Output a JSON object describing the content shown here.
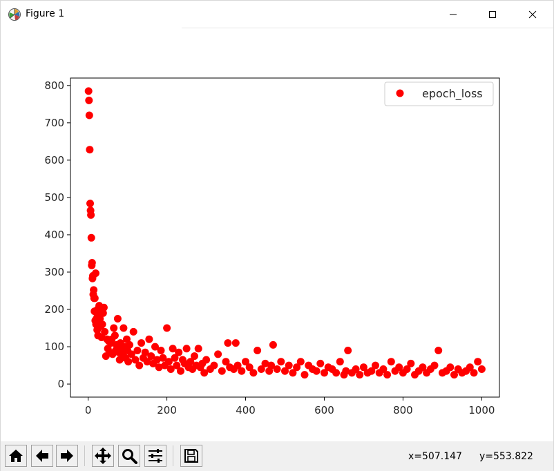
{
  "window": {
    "title": "Figure 1",
    "icons": [
      "matplotlib-icon",
      "minimize-icon",
      "maximize-icon",
      "close-icon"
    ]
  },
  "toolbar": {
    "tools": [
      {
        "name": "home-button",
        "icon": "home-icon"
      },
      {
        "name": "back-button",
        "icon": "arrow-left-icon"
      },
      {
        "name": "forward-button",
        "icon": "arrow-right-icon"
      },
      {
        "name": "pan-button",
        "icon": "move-icon"
      },
      {
        "name": "zoom-button",
        "icon": "magnifier-icon"
      },
      {
        "name": "configure-subplots-button",
        "icon": "sliders-icon"
      },
      {
        "name": "save-button",
        "icon": "floppy-disk-icon"
      }
    ],
    "x_readout": "x=507.147",
    "y_readout": "y=553.822"
  },
  "chart_data": {
    "type": "scatter",
    "title": "",
    "xlabel": "",
    "ylabel": "",
    "xlim": [
      -45,
      1045
    ],
    "ylim": [
      -35,
      820
    ],
    "xticks": [
      0,
      200,
      400,
      600,
      800,
      1000
    ],
    "yticks": [
      0,
      100,
      200,
      300,
      400,
      500,
      600,
      700,
      800
    ],
    "legend": {
      "position": "top-right"
    },
    "marker_color": "#ff0000",
    "series": [
      {
        "name": "epoch_loss",
        "x": [
          1,
          2,
          3,
          4,
          5,
          6,
          7,
          8,
          9,
          10,
          11,
          12,
          13,
          14,
          15,
          16,
          17,
          18,
          19,
          20,
          21,
          22,
          23,
          24,
          25,
          26,
          28,
          30,
          32,
          34,
          36,
          38,
          40,
          42,
          45,
          48,
          50,
          52,
          55,
          58,
          60,
          62,
          65,
          68,
          70,
          72,
          75,
          78,
          80,
          82,
          85,
          88,
          90,
          92,
          95,
          98,
          100,
          102,
          105,
          110,
          115,
          120,
          125,
          130,
          135,
          140,
          145,
          150,
          155,
          160,
          165,
          170,
          175,
          180,
          185,
          190,
          195,
          200,
          205,
          210,
          215,
          220,
          225,
          230,
          235,
          240,
          245,
          250,
          255,
          260,
          265,
          270,
          275,
          280,
          285,
          290,
          295,
          300,
          310,
          320,
          330,
          340,
          350,
          355,
          360,
          370,
          375,
          380,
          390,
          400,
          410,
          420,
          430,
          440,
          450,
          460,
          465,
          470,
          480,
          490,
          500,
          510,
          520,
          530,
          540,
          550,
          560,
          570,
          580,
          590,
          600,
          610,
          620,
          630,
          640,
          650,
          655,
          660,
          670,
          680,
          690,
          700,
          710,
          720,
          730,
          740,
          750,
          760,
          770,
          780,
          790,
          800,
          810,
          820,
          830,
          840,
          850,
          860,
          870,
          880,
          890,
          900,
          910,
          920,
          930,
          940,
          950,
          960,
          970,
          980,
          990,
          1000
        ],
        "y": [
          785,
          760,
          720,
          628,
          484,
          465,
          453,
          392,
          318,
          325,
          283,
          290,
          240,
          252,
          230,
          195,
          230,
          170,
          297,
          160,
          175,
          190,
          145,
          200,
          130,
          165,
          210,
          175,
          155,
          125,
          160,
          190,
          205,
          140,
          75,
          120,
          95,
          115,
          85,
          110,
          120,
          80,
          150,
          130,
          90,
          105,
          175,
          85,
          65,
          110,
          95,
          80,
          150,
          100,
          70,
          120,
          90,
          60,
          105,
          80,
          140,
          65,
          90,
          50,
          110,
          70,
          85,
          60,
          120,
          75,
          55,
          100,
          65,
          45,
          90,
          70,
          50,
          150,
          60,
          40,
          95,
          70,
          50,
          85,
          35,
          65,
          55,
          95,
          45,
          60,
          40,
          75,
          50,
          95,
          45,
          55,
          30,
          65,
          40,
          50,
          80,
          35,
          60,
          110,
          45,
          40,
          110,
          50,
          35,
          60,
          45,
          30,
          90,
          40,
          55,
          35,
          50,
          105,
          40,
          60,
          35,
          50,
          30,
          45,
          60,
          25,
          50,
          40,
          35,
          55,
          30,
          45,
          40,
          30,
          60,
          25,
          35,
          90,
          30,
          40,
          25,
          45,
          30,
          35,
          50,
          30,
          40,
          25,
          60,
          35,
          45,
          30,
          40,
          55,
          25,
          35,
          45,
          30,
          40,
          50,
          90,
          30,
          35,
          45,
          25,
          40,
          30,
          35,
          45,
          30,
          60,
          40
        ]
      }
    ]
  }
}
